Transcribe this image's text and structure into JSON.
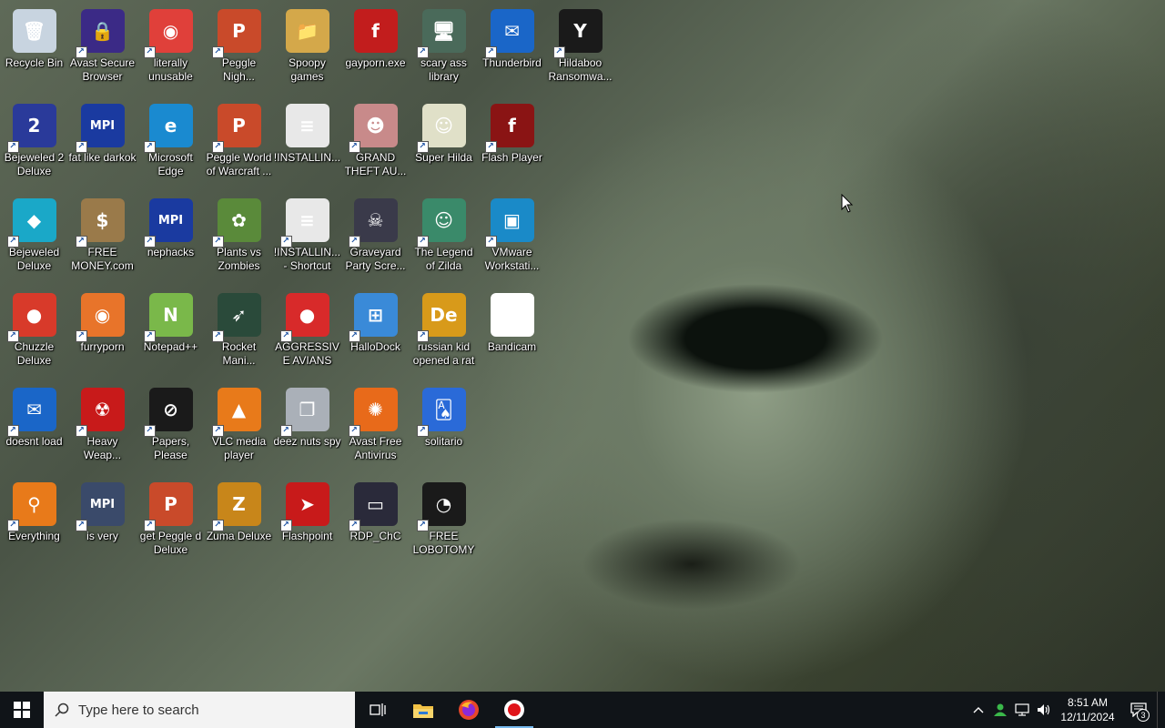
{
  "desktop": {
    "icons": [
      {
        "label": "Recycle Bin",
        "glyph": "🗑",
        "bg": "#c8d4e0",
        "shortcut": false
      },
      {
        "label": "Avast Secure Browser",
        "glyph": "🔒",
        "bg": "#3b2a86",
        "shortcut": true
      },
      {
        "label": "literally unusable",
        "glyph": "◉",
        "bg": "#e0403a",
        "shortcut": true
      },
      {
        "label": "Peggle Nigh...",
        "glyph": "P",
        "bg": "#c94a2a",
        "shortcut": true
      },
      {
        "label": "Spoopy games",
        "glyph": "📁",
        "bg": "#d4a84a",
        "shortcut": false
      },
      {
        "label": "gayporn.exe",
        "glyph": "f",
        "bg": "#c21d1d",
        "shortcut": false
      },
      {
        "label": "scary ass library",
        "glyph": "🖥",
        "bg": "#4a6a5a",
        "shortcut": true
      },
      {
        "label": "Thunderbird",
        "glyph": "✉",
        "bg": "#1a66c8",
        "shortcut": true
      },
      {
        "label": "Hildaboo Ransomwa...",
        "glyph": "Y",
        "bg": "#1a1a1a",
        "shortcut": true
      },
      {
        "label": "Bejeweled 2 Deluxe",
        "glyph": "2",
        "bg": "#2a3a9a",
        "shortcut": true
      },
      {
        "label": "fat like darkok",
        "glyph": "MPI",
        "bg": "#1a3aa0",
        "shortcut": true
      },
      {
        "label": "Microsoft Edge",
        "glyph": "e",
        "bg": "#1a8ad0",
        "shortcut": true
      },
      {
        "label": "Peggle World of Warcraft ...",
        "glyph": "P",
        "bg": "#c94a2a",
        "shortcut": true
      },
      {
        "label": "!INSTALLIN...",
        "glyph": "≡",
        "bg": "#e8e8e8",
        "shortcut": false
      },
      {
        "label": "GRAND THEFT AU...",
        "glyph": "☻",
        "bg": "#c88a8a",
        "shortcut": true
      },
      {
        "label": "Super Hilda",
        "glyph": "☺",
        "bg": "#e0e0c8",
        "shortcut": true
      },
      {
        "label": "Flash Player",
        "glyph": "f",
        "bg": "#8a1414",
        "shortcut": true
      },
      {
        "label": "Bejeweled Deluxe",
        "glyph": "◆",
        "bg": "#1aa8c8",
        "shortcut": true
      },
      {
        "label": "FREE MONEY.com",
        "glyph": "$",
        "bg": "#9a7a4a",
        "shortcut": true
      },
      {
        "label": "nephacks",
        "glyph": "MPI",
        "bg": "#1a3aa0",
        "shortcut": true
      },
      {
        "label": "Plants vs Zombies",
        "glyph": "✿",
        "bg": "#5a8a3a",
        "shortcut": true
      },
      {
        "label": "!INSTALLIN... - Shortcut",
        "glyph": "≡",
        "bg": "#e8e8e8",
        "shortcut": true
      },
      {
        "label": "Graveyard Party Scre...",
        "glyph": "☠",
        "bg": "#3a3a4a",
        "shortcut": true
      },
      {
        "label": "The Legend of Zilda",
        "glyph": "☺",
        "bg": "#3a8a6a",
        "shortcut": true
      },
      {
        "label": "VMware Workstati...",
        "glyph": "▣",
        "bg": "#1a8ac8",
        "shortcut": true
      },
      {
        "label": "Chuzzle Deluxe",
        "glyph": "●",
        "bg": "#d83a2a",
        "shortcut": true
      },
      {
        "label": "furryporn",
        "glyph": "◉",
        "bg": "#e8742a",
        "shortcut": true
      },
      {
        "label": "Notepad++",
        "glyph": "N",
        "bg": "#7ab84a",
        "shortcut": true
      },
      {
        "label": "Rocket Mani...",
        "glyph": "➶",
        "bg": "#2a4a3a",
        "shortcut": true
      },
      {
        "label": "AGGRESSIVE AVIANS",
        "glyph": "●",
        "bg": "#d82a2a",
        "shortcut": true
      },
      {
        "label": "HalloDock",
        "glyph": "⊞",
        "bg": "#3a8ad8",
        "shortcut": true
      },
      {
        "label": "russian kid opened a rat",
        "glyph": "De",
        "bg": "#d89a1a",
        "shortcut": true
      },
      {
        "label": "Bandicam",
        "glyph": "●",
        "bg": "#ffffff",
        "shortcut": false
      },
      {
        "label": "doesnt load",
        "glyph": "✉",
        "bg": "#1a66c8",
        "shortcut": true
      },
      {
        "label": "Heavy Weap...",
        "glyph": "☢",
        "bg": "#c81a1a",
        "shortcut": true
      },
      {
        "label": "Papers, Please",
        "glyph": "⊘",
        "bg": "#1a1a1a",
        "shortcut": true
      },
      {
        "label": "VLC media player",
        "glyph": "▲",
        "bg": "#e87a1a",
        "shortcut": true
      },
      {
        "label": "deez nuts spy",
        "glyph": "❐",
        "bg": "#aab0b8",
        "shortcut": true
      },
      {
        "label": "Avast Free Antivirus",
        "glyph": "✺",
        "bg": "#e86a1a",
        "shortcut": true
      },
      {
        "label": "solitario",
        "glyph": "🂡",
        "bg": "#2a6ad8",
        "shortcut": true
      },
      {
        "label": "Everything",
        "glyph": "⚲",
        "bg": "#e87a1a",
        "shortcut": true
      },
      {
        "label": "is very",
        "glyph": "MPI",
        "bg": "#3a4a6a",
        "shortcut": true
      },
      {
        "label": "get Peggle d Deluxe",
        "glyph": "P",
        "bg": "#c94a2a",
        "shortcut": true
      },
      {
        "label": "Zuma Deluxe",
        "glyph": "Z",
        "bg": "#c8861a",
        "shortcut": true
      },
      {
        "label": "Flashpoint",
        "glyph": "➤",
        "bg": "#c81a1a",
        "shortcut": true
      },
      {
        "label": "RDP_ChC",
        "glyph": "▭",
        "bg": "#2a2a3a",
        "shortcut": true
      },
      {
        "label": "FREE LOBOTOMYS",
        "glyph": "◔",
        "bg": "#1a1a1a",
        "shortcut": true
      }
    ]
  },
  "taskbar": {
    "start_icon": "windows-logo-icon",
    "search_placeholder": "Type here to search",
    "pinned": [
      {
        "name": "task-view",
        "glyph": "⧉"
      },
      {
        "name": "file-explorer",
        "glyph": "📁"
      },
      {
        "name": "firefox",
        "glyph": "◉"
      },
      {
        "name": "bandicam",
        "glyph": "●"
      }
    ],
    "tray": {
      "time": "8:51 AM",
      "date": "12/11/2024",
      "notification_count": "3"
    }
  }
}
